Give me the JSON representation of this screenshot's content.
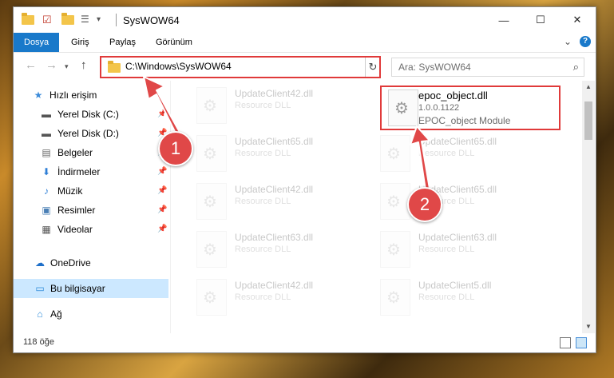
{
  "window": {
    "title": "SysWOW64",
    "controls": {
      "minimize": "—",
      "maximize": "☐",
      "close": "✕"
    }
  },
  "ribbon": {
    "tabs": [
      "Dosya",
      "Giriş",
      "Paylaş",
      "Görünüm"
    ],
    "expand_icon": "chevron-down-icon",
    "help": "?"
  },
  "address": {
    "path": "C:\\Windows\\SysWOW64",
    "search_placeholder": "Ara: SysWOW64"
  },
  "nav": {
    "items": [
      {
        "label": "Hızlı erişim",
        "icon": "star-icon",
        "glyph": "★",
        "color": "#3c8bd9"
      },
      {
        "label": "Yerel Disk (C:)",
        "icon": "drive-icon",
        "glyph": "▬",
        "color": "#555555",
        "pinned": true
      },
      {
        "label": "Yerel Disk (D:)",
        "icon": "drive-icon",
        "glyph": "▬",
        "color": "#555555",
        "pinned": true
      },
      {
        "label": "Belgeler",
        "icon": "document-icon",
        "glyph": "▤",
        "color": "#666666",
        "pinned": true
      },
      {
        "label": "İndirmeler",
        "icon": "download-icon",
        "glyph": "⬇",
        "color": "#2f7fd6",
        "pinned": true
      },
      {
        "label": "Müzik",
        "icon": "music-icon",
        "glyph": "♪",
        "color": "#2f7fd6",
        "pinned": true
      },
      {
        "label": "Resimler",
        "icon": "pictures-icon",
        "glyph": "▣",
        "color": "#4a7fb5",
        "pinned": true
      },
      {
        "label": "Videolar",
        "icon": "video-icon",
        "glyph": "▦",
        "color": "#555555",
        "pinned": true
      },
      {
        "label": "OneDrive",
        "icon": "cloud-icon",
        "glyph": "☁",
        "color": "#1e6fc9"
      },
      {
        "label": "Bu bilgisayar",
        "icon": "computer-icon",
        "glyph": "▭",
        "color": "#2b8ad9",
        "selected": true
      },
      {
        "label": "Ağ",
        "icon": "network-icon",
        "glyph": "⌂",
        "color": "#2b8ad9"
      }
    ]
  },
  "files": {
    "left": [
      {
        "name": "UpdateClient42.dll",
        "type": "Resource DLL"
      },
      {
        "name": "UpdateClient65.dll",
        "type": "Resource DLL"
      },
      {
        "name": "UpdateClient42.dll",
        "type": "Resource DLL"
      },
      {
        "name": "UpdateClient63.dll",
        "type": "Resource DLL"
      },
      {
        "name": "UpdateClient42.dll",
        "type": "Resource DLL"
      }
    ],
    "selected": {
      "name": "epoc_object.dll",
      "version": "1.0.0.1122",
      "description": "EPOC_object Module"
    },
    "right": [
      {
        "name": "UpdateClient65.dll",
        "type": "Resource DLL"
      },
      {
        "name": "UpdateClient65.dll",
        "type": "Resource DLL"
      },
      {
        "name": "UpdateClient63.dll",
        "type": "Resource DLL"
      },
      {
        "name": "UpdateClient5.dll",
        "type": "Resource DLL"
      }
    ]
  },
  "status": {
    "count": "118 öğe"
  },
  "annotations": {
    "step1": "1",
    "step2": "2",
    "accent": "#e04848"
  }
}
